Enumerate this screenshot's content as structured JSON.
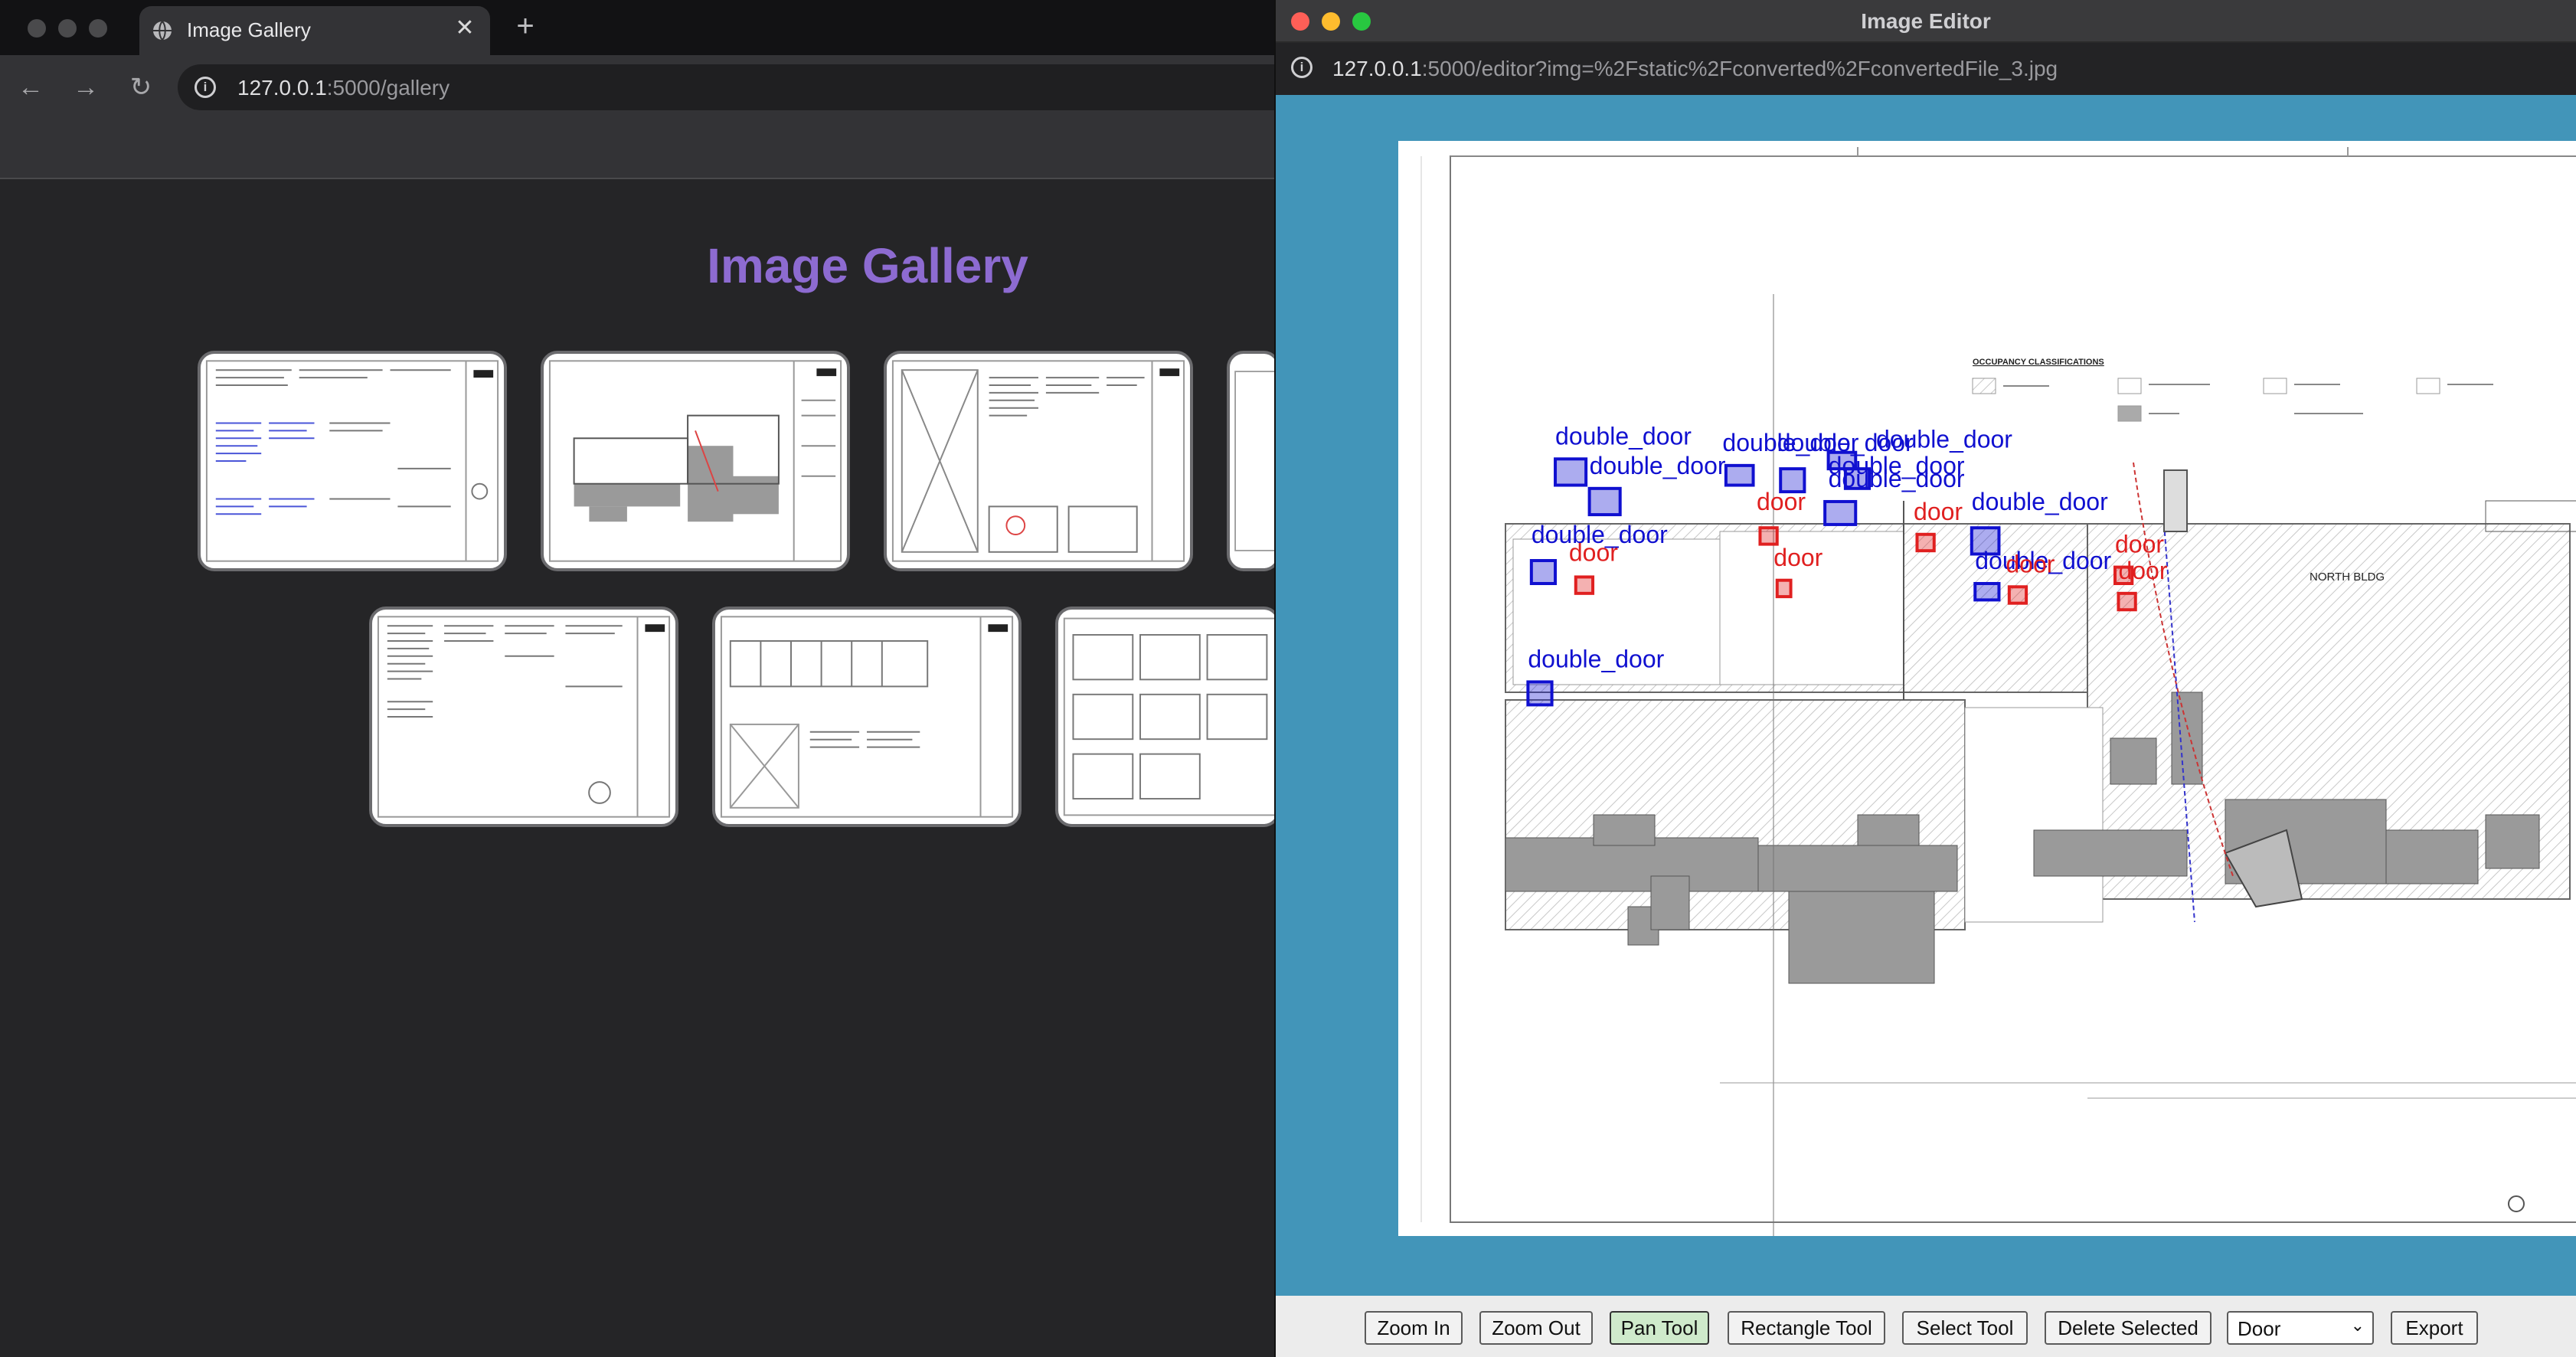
{
  "browser": {
    "tab_title": "Image Gallery",
    "tab_close": "✕",
    "new_tab": "+",
    "back": "←",
    "forward": "→",
    "reload": "↻",
    "url_host": "127.0.0.1",
    "url_path": ":5000/gallery"
  },
  "gallery": {
    "title": "Image Gallery"
  },
  "editor": {
    "window_title": "Image Editor",
    "url_host": "127.0.0.1",
    "url_path": ":5000/editor?img=%2Fstatic%2Fconverted%2FconvertedFile_3.jpg",
    "plan": {
      "occupancy_title": "OCCUPANCY CLASSIFICATIONS",
      "building_label": "NORTH BLDG",
      "annotations": [
        {
          "label": "double_door",
          "color": "#1010d0"
        },
        {
          "label": "double_door",
          "color": "#1010d0"
        },
        {
          "label": "double_door",
          "color": "#1010d0"
        },
        {
          "label": "double_door",
          "color": "#1010d0"
        },
        {
          "label": "double_door",
          "color": "#1010d0"
        },
        {
          "label": "double_door",
          "color": "#1010d0"
        },
        {
          "label": "double_door",
          "color": "#1010d0"
        },
        {
          "label": "double_door",
          "color": "#1010d0"
        },
        {
          "label": "double_door",
          "color": "#1010d0"
        },
        {
          "label": "double_door",
          "color": "#1010d0"
        },
        {
          "label": "double_door",
          "color": "#1010d0"
        },
        {
          "label": "door",
          "color": "#e02020"
        },
        {
          "label": "door",
          "color": "#e02020"
        },
        {
          "label": "door",
          "color": "#e02020"
        },
        {
          "label": "door",
          "color": "#e02020"
        },
        {
          "label": "door",
          "color": "#e02020"
        },
        {
          "label": "door",
          "color": "#e02020"
        },
        {
          "label": "door",
          "color": "#e02020"
        }
      ]
    },
    "toolbar": {
      "zoom_in": "Zoom In",
      "zoom_out": "Zoom Out",
      "pan_tool": "Pan Tool",
      "rectangle_tool": "Rectangle Tool",
      "select_tool": "Select Tool",
      "delete_selected": "Delete Selected",
      "label_select": "Door",
      "export": "Export"
    }
  },
  "colors": {
    "gallery_title": "#8d6bd1",
    "canvas_bg": "#4295b9",
    "double_door": "#1010d0",
    "door": "#e02020",
    "active_tool": "#cfeacb"
  }
}
